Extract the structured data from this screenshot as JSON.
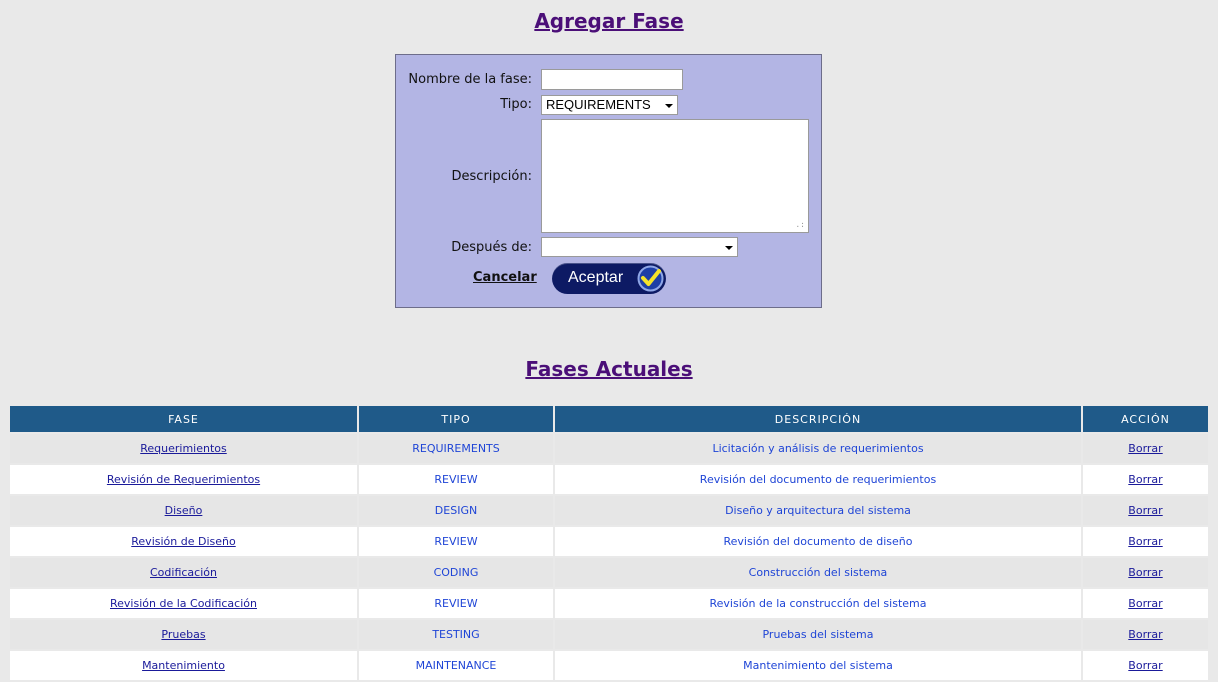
{
  "form": {
    "title": "Agregar Fase",
    "name_label": "Nombre de la fase:",
    "name_value": "",
    "type_label": "Tipo:",
    "type_value": "REQUIREMENTS",
    "description_label": "Descripción:",
    "description_value": "",
    "after_label": "Después de:",
    "after_value": "",
    "cancel_label": "Cancelar",
    "accept_label": "Aceptar"
  },
  "table": {
    "title": "Fases Actuales",
    "headers": [
      "FASE",
      "TIPO",
      "DESCRIPCIÓN",
      "ACCIÓN"
    ],
    "rows": [
      {
        "fase": "Requerimientos",
        "tipo": "REQUIREMENTS",
        "descripcion": "Licitación y análisis de requerimientos",
        "accion": "Borrar"
      },
      {
        "fase": "Revisión de Requerimientos",
        "tipo": "REVIEW",
        "descripcion": "Revisión del documento de requerimientos",
        "accion": "Borrar"
      },
      {
        "fase": "Diseño",
        "tipo": "DESIGN",
        "descripcion": "Diseño y arquitectura del sistema",
        "accion": "Borrar"
      },
      {
        "fase": "Revisión de Diseño",
        "tipo": "REVIEW",
        "descripcion": "Revisión del documento de diseño",
        "accion": "Borrar"
      },
      {
        "fase": "Codificación",
        "tipo": "CODING",
        "descripcion": "Construcción del sistema",
        "accion": "Borrar"
      },
      {
        "fase": "Revisión de la Codificación",
        "tipo": "REVIEW",
        "descripcion": "Revisión de la construcción del sistema",
        "accion": "Borrar"
      },
      {
        "fase": "Pruebas",
        "tipo": "TESTING",
        "descripcion": "Pruebas del sistema",
        "accion": "Borrar"
      },
      {
        "fase": "Mantenimiento",
        "tipo": "MAINTENANCE",
        "descripcion": "Mantenimiento del sistema",
        "accion": "Borrar"
      }
    ]
  },
  "colors": {
    "background": "#e9e9e9",
    "form_background": "#b3b5e4",
    "header_background": "#1f5a89",
    "title_color": "#4b0f78",
    "accept_button": "#0d1a64"
  },
  "icons": {
    "accept": "check-icon",
    "select_arrow": "chevron-down-icon"
  }
}
